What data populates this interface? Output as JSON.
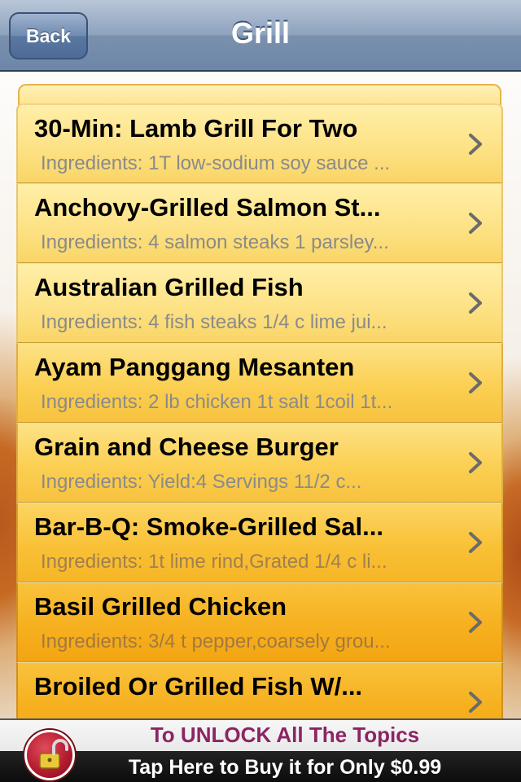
{
  "navbar": {
    "back_label": "Back",
    "title": "Grill"
  },
  "recipes": [
    {
      "title": "30-Min: Lamb Grill For Two",
      "subtitle": "Ingredients: 1T low-sodium soy sauce ..."
    },
    {
      "title": "Anchovy-Grilled Salmon St...",
      "subtitle": "Ingredients: 4 salmon steaks 1 parsley..."
    },
    {
      "title": "Australian Grilled Fish",
      "subtitle": "Ingredients: 4 fish steaks 1/4 c lime jui..."
    },
    {
      "title": "Ayam Panggang Mesanten",
      "subtitle": "Ingredients: 2 lb chicken 1t salt 1coil 1t..."
    },
    {
      "title": "Grain and Cheese Burger",
      "subtitle": "Ingredients: Yield:4 Servings 11/2 c..."
    },
    {
      "title": "Bar-B-Q: Smoke-Grilled Sal...",
      "subtitle": "Ingredients: 1t lime rind,Grated 1/4 c li..."
    },
    {
      "title": "Basil Grilled Chicken",
      "subtitle": "Ingredients: 3/4 t pepper,coarsely grou..."
    },
    {
      "title": "Broiled Or Grilled Fish W/...",
      "subtitle": ""
    }
  ],
  "banner": {
    "line1": "To UNLOCK All The Topics",
    "line2": "Tap Here to Buy it for Only $0.99",
    "icon": "unlock-icon"
  },
  "colors": {
    "nav_bar": "#7a90ae",
    "row_light": "#ffefa8",
    "row_warm": "#f9c137",
    "banner_text": "#8b2563"
  }
}
